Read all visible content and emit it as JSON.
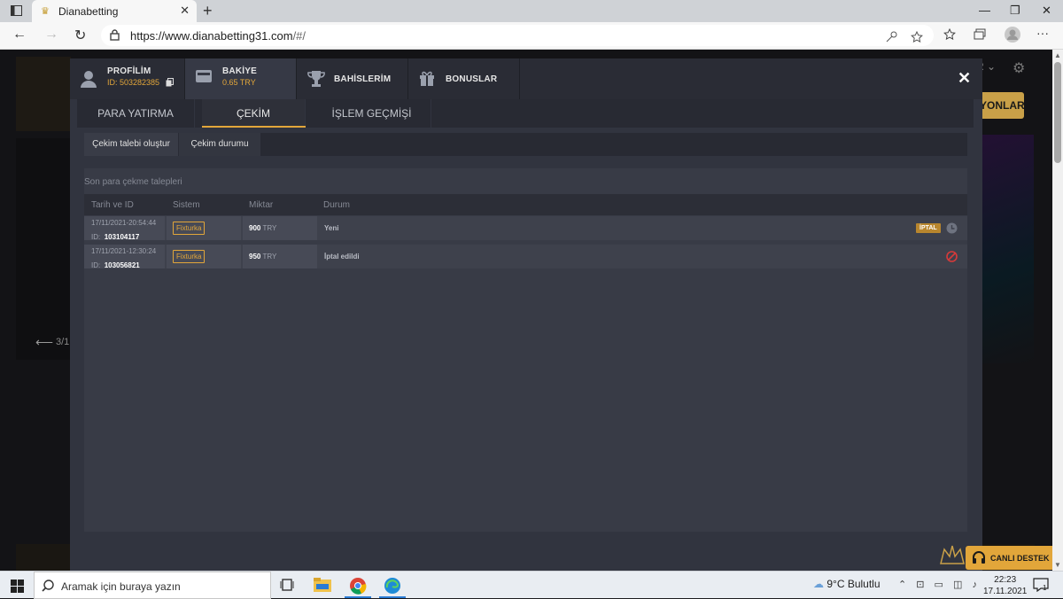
{
  "browser": {
    "tab_title": "Dianabetting",
    "url_host": "https://www.dianabetting31.com",
    "url_path": "/#/"
  },
  "modal": {
    "nav": {
      "profile_label": "PROFİLİM",
      "profile_id": "ID: 503282385",
      "balance_label": "BAKİYE",
      "balance_value": "0.65 TRY",
      "bets_label": "BAHİSLERİM",
      "bonus_label": "BONUSLAR"
    },
    "subtabs": {
      "deposit": "PARA YATIRMA",
      "withdraw": "ÇEKİM",
      "history": "İŞLEM GEÇMİŞİ"
    },
    "actions": {
      "create": "Çekim talebi oluştur",
      "status": "Çekim durumu"
    },
    "panel_title": "Son para çekme talepleri",
    "table": {
      "headers": [
        "Tarih ve ID",
        "Sistem",
        "Miktar",
        "Durum"
      ],
      "rows": [
        {
          "date": "17/11/2021-20:54:44",
          "id_label": "ID:",
          "id": "103104117",
          "system": "Fixturka",
          "amount": "900",
          "currency": "TRY",
          "status": "Yeni",
          "action": "İPTAL"
        },
        {
          "date": "17/11/2021-12:30:24",
          "id_label": "ID:",
          "id": "103056821",
          "system": "Fixturka",
          "amount": "950",
          "currency": "TRY",
          "status": "İptal edildi"
        }
      ]
    }
  },
  "background": {
    "right_button": "YONLAR",
    "right_top": "R",
    "slider_counter": "3/1"
  },
  "support": {
    "label": "CANLI DESTEK"
  },
  "taskbar": {
    "search_placeholder": "Aramak için buraya yazın",
    "weather": "9°C  Bulutlu",
    "time": "22:23",
    "date": "17.11.2021",
    "notifications": "1"
  },
  "colors": {
    "accent": "#e2a63a",
    "modal_bg": "#31343f",
    "cancel_red": "#d63a3a"
  }
}
